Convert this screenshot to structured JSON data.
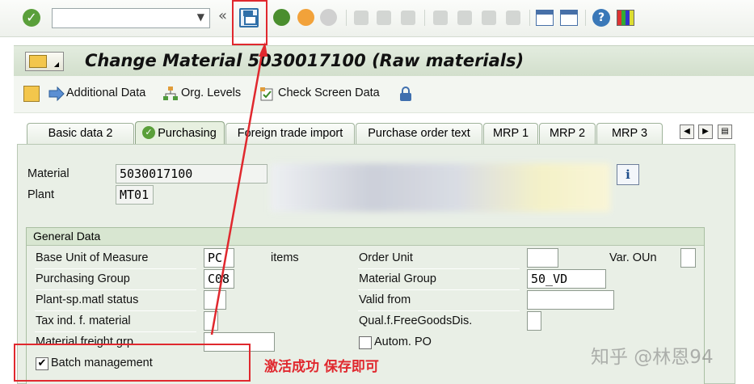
{
  "toolbar": {
    "command_field_value": "",
    "icons": [
      "enter-icon",
      "save-icon",
      "back-icon",
      "exit-icon",
      "cancel-icon",
      "print-icon",
      "find-icon",
      "find-next-icon",
      "first-page-icon",
      "prev-page-icon",
      "next-page-icon",
      "last-page-icon",
      "new-session-icon",
      "shortcut-icon",
      "help-icon",
      "layout-icon"
    ]
  },
  "title": {
    "text": "Change Material 5030017100 (Raw materials)"
  },
  "app_toolbar": {
    "additional_data": "Additional Data",
    "org_levels": "Org. Levels",
    "check_screen_data": "Check Screen Data"
  },
  "tabs": [
    {
      "label": "Basic data 2",
      "active": false
    },
    {
      "label": "Purchasing",
      "active": true
    },
    {
      "label": "Foreign trade import",
      "active": false
    },
    {
      "label": "Purchase order text",
      "active": false
    },
    {
      "label": "MRP 1",
      "active": false
    },
    {
      "label": "MRP 2",
      "active": false
    },
    {
      "label": "MRP 3",
      "active": false
    }
  ],
  "header": {
    "material_label": "Material",
    "material_value": "5030017100",
    "plant_label": "Plant",
    "plant_value": "MT01"
  },
  "general": {
    "title": "General Data",
    "base_uom_label": "Base Unit of Measure",
    "base_uom_value": "PC",
    "base_uom_text": "items",
    "order_unit_label": "Order Unit",
    "order_unit_value": "",
    "var_oun_label": "Var. OUn",
    "purchasing_group_label": "Purchasing Group",
    "purchasing_group_value": "C08",
    "material_group_label": "Material Group",
    "material_group_value": "50_VD",
    "plant_status_label": "Plant-sp.matl status",
    "valid_from_label": "Valid from",
    "tax_ind_label": "Tax ind. f. material",
    "qual_free_goods_label": "Qual.f.FreeGoodsDis.",
    "freight_grp_label": "Material freight grp",
    "autom_po_label": "Autom. PO",
    "autom_po_checked": false,
    "batch_mgmt_label": "Batch management",
    "batch_mgmt_checked": true
  },
  "annotation": {
    "text": "激活成功 保存即可",
    "color": "#e0282e"
  },
  "watermark": "知乎 @林恩94"
}
